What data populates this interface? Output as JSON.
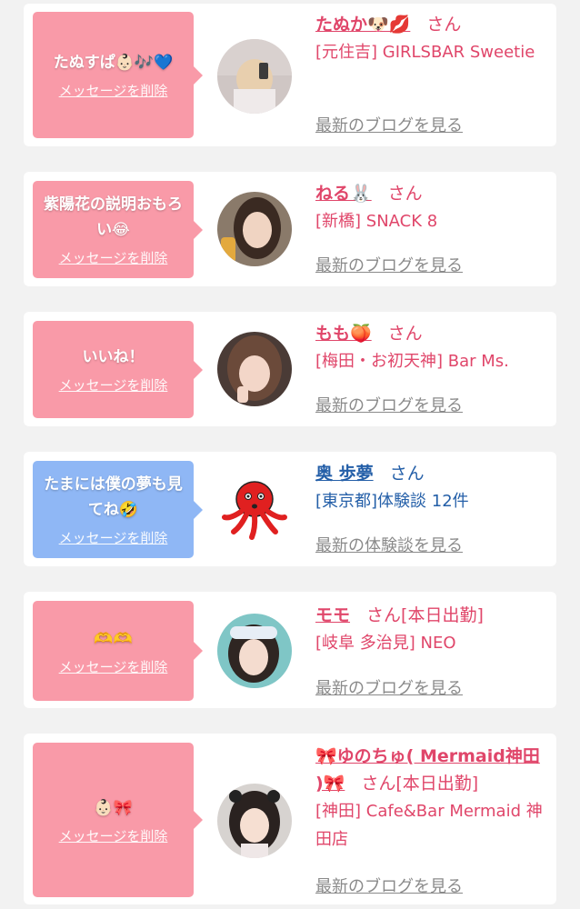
{
  "cards": [
    {
      "message": "たぬすぱ👶🏻🎶💙",
      "delete_label": "メッセージを削除",
      "name": "たぬか🐶💋",
      "honorific": "さん",
      "shop": "[元住吉] GIRLSBAR Sweetie",
      "blog_link": "最新のブログを見る"
    },
    {
      "message": "紫陽花の説明おもろい😂",
      "delete_label": "メッセージを削除",
      "name": "ねる🐰",
      "honorific": "さん",
      "shop": "[新橋] SNACK 8",
      "blog_link": "最新のブログを見る"
    },
    {
      "message": "いいね！",
      "delete_label": "メッセージを削除",
      "name": "もも🍑",
      "honorific": "さん",
      "shop": "[梅田・お初天神] Bar Ms.",
      "blog_link": "最新のブログを見る"
    },
    {
      "message": "たまには僕の夢も見てね🤣",
      "delete_label": "メッセージを削除",
      "name": "奥 歩夢",
      "honorific": "さん",
      "shop": "[東京都]体験談 12件",
      "blog_link": "最新の体験談を見る"
    },
    {
      "message": "🫶🫶",
      "delete_label": "メッセージを削除",
      "name": "モモ",
      "honorific": "さん",
      "status": "[本日出勤]",
      "shop": "[岐阜 多治見] NEO",
      "blog_link": "最新のブログを見る"
    },
    {
      "message": "👶🏻🎀",
      "delete_label": "メッセージを削除",
      "name": "🎀ゆのちゅ( Mermaid神田 )🎀",
      "honorific": "さん",
      "status": "[本日出勤]",
      "shop": "[神田] Cafe&Bar Mermaid 神田店",
      "blog_link": "最新のブログを見る"
    }
  ],
  "colors": {
    "pink_bubble": "#f99aa8",
    "blue_bubble": "#8fb7f5",
    "pink_text": "#e0466a",
    "blue_text": "#245fa8",
    "link_gray": "#8a8a8a"
  }
}
